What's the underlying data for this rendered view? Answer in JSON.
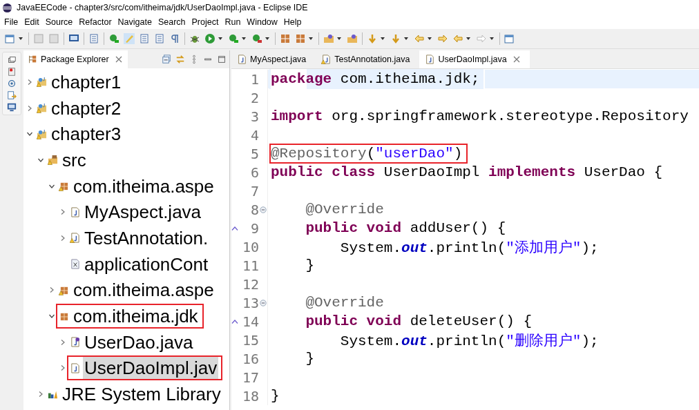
{
  "window": {
    "title": "JavaEECode - chapter3/src/com/itheima/jdk/UserDaoImpl.java - Eclipse IDE"
  },
  "menu": [
    {
      "label": "File"
    },
    {
      "label": "Edit"
    },
    {
      "label": "Source"
    },
    {
      "label": "Refactor"
    },
    {
      "label": "Navigate"
    },
    {
      "label": "Search"
    },
    {
      "label": "Project"
    },
    {
      "label": "Run"
    },
    {
      "label": "Window"
    },
    {
      "label": "Help"
    }
  ],
  "package_explorer": {
    "title": "Package Explorer",
    "tree": [
      {
        "label": "chapter1",
        "kind": "project",
        "warning": true,
        "expanded": false,
        "selected": false,
        "highlighted": false
      },
      {
        "label": "chapter2",
        "kind": "project",
        "warning": true,
        "expanded": false,
        "selected": false,
        "highlighted": false
      },
      {
        "label": "chapter3",
        "kind": "project",
        "warning": true,
        "expanded": true,
        "selected": false,
        "highlighted": false,
        "children": [
          {
            "label": "src",
            "kind": "source-folder",
            "warning": true,
            "expanded": true,
            "selected": false,
            "highlighted": false,
            "children": [
              {
                "label": "com.itheima.aspe",
                "kind": "package",
                "warning": true,
                "expanded": true,
                "selected": false,
                "highlighted": false,
                "children": [
                  {
                    "label": "MyAspect.java",
                    "kind": "java-file",
                    "warning": false,
                    "expanded": false,
                    "selected": false,
                    "highlighted": false
                  },
                  {
                    "label": "TestAnnotation.",
                    "kind": "java-file",
                    "warning": true,
                    "expanded": false,
                    "selected": false,
                    "highlighted": false
                  },
                  {
                    "label": "applicationCont",
                    "kind": "xml-file",
                    "warning": false,
                    "selected": false,
                    "highlighted": false
                  }
                ]
              },
              {
                "label": "com.itheima.aspe",
                "kind": "package",
                "warning": true,
                "expanded": false,
                "selected": false,
                "highlighted": false
              },
              {
                "label": "com.itheima.jdk",
                "kind": "package",
                "warning": false,
                "expanded": true,
                "selected": false,
                "highlighted": true,
                "children": [
                  {
                    "label": "UserDao.java",
                    "kind": "interface-file",
                    "warning": false,
                    "expanded": false,
                    "selected": false,
                    "highlighted": false
                  },
                  {
                    "label": "UserDaoImpl.jav",
                    "kind": "java-file",
                    "warning": false,
                    "expanded": false,
                    "selected": true,
                    "highlighted": true
                  }
                ]
              }
            ]
          },
          {
            "label": "JRE System Library",
            "kind": "library",
            "warning": false,
            "expanded": false,
            "selected": false,
            "highlighted": false
          }
        ]
      }
    ]
  },
  "editor": {
    "tabs": [
      {
        "label": "MyAspect.java",
        "warning": false,
        "selected": false
      },
      {
        "label": "TestAnnotation.java",
        "warning": true,
        "selected": false
      },
      {
        "label": "UserDaoImpl.java",
        "warning": false,
        "selected": true
      }
    ],
    "lines": [
      {
        "number": "1",
        "current": true,
        "fold": false,
        "override": false,
        "highlighted": false,
        "tokens": [
          {
            "kind": "keyword",
            "text": "package"
          },
          {
            "kind": "plain",
            "text": " com.itheima.jdk;"
          }
        ]
      },
      {
        "number": "2",
        "current": false,
        "fold": false,
        "override": false,
        "highlighted": false
      },
      {
        "number": "3",
        "current": false,
        "fold": false,
        "override": false,
        "highlighted": false,
        "tokens": [
          {
            "kind": "keyword",
            "text": "import"
          },
          {
            "kind": "plain",
            "text": " org.springframework.stereotype.Repository"
          }
        ]
      },
      {
        "number": "4",
        "current": false,
        "fold": false,
        "override": false,
        "highlighted": false
      },
      {
        "number": "5",
        "current": false,
        "fold": false,
        "override": false,
        "highlighted": true,
        "tokens": [
          {
            "kind": "annotation",
            "text": "@Repository"
          },
          {
            "kind": "plain",
            "text": "("
          },
          {
            "kind": "string",
            "text": "\"userDao\""
          },
          {
            "kind": "plain",
            "text": ")"
          }
        ]
      },
      {
        "number": "6",
        "current": false,
        "fold": false,
        "override": false,
        "highlighted": false,
        "tokens": [
          {
            "kind": "keyword",
            "text": "public class"
          },
          {
            "kind": "plain",
            "text": " UserDaoImpl "
          },
          {
            "kind": "keyword",
            "text": "implements"
          },
          {
            "kind": "plain",
            "text": " UserDao {"
          }
        ]
      },
      {
        "number": "7",
        "current": false,
        "fold": false,
        "override": false,
        "highlighted": false
      },
      {
        "number": "8",
        "current": false,
        "fold": true,
        "override": false,
        "highlighted": false,
        "tokens": [
          {
            "kind": "annotation",
            "text": "    @Override"
          }
        ]
      },
      {
        "number": "9",
        "current": false,
        "fold": false,
        "override": true,
        "highlighted": false,
        "tokens": [
          {
            "kind": "keyword",
            "text": "    public void"
          },
          {
            "kind": "plain",
            "text": " addUser() {"
          }
        ]
      },
      {
        "number": "10",
        "current": false,
        "fold": false,
        "override": false,
        "highlighted": false,
        "tokens": [
          {
            "kind": "plain",
            "text": "        System."
          },
          {
            "kind": "field",
            "text": "out"
          },
          {
            "kind": "plain",
            "text": ".println("
          },
          {
            "kind": "string",
            "text": "\"添加用户\""
          },
          {
            "kind": "plain",
            "text": ");"
          }
        ]
      },
      {
        "number": "11",
        "current": false,
        "fold": false,
        "override": false,
        "highlighted": false,
        "tokens": [
          {
            "kind": "plain",
            "text": "    }"
          }
        ]
      },
      {
        "number": "12",
        "current": false,
        "fold": false,
        "override": false,
        "highlighted": false
      },
      {
        "number": "13",
        "current": false,
        "fold": true,
        "override": false,
        "highlighted": false,
        "tokens": [
          {
            "kind": "annotation",
            "text": "    @Override"
          }
        ]
      },
      {
        "number": "14",
        "current": false,
        "fold": false,
        "override": true,
        "highlighted": false,
        "tokens": [
          {
            "kind": "keyword",
            "text": "    public void"
          },
          {
            "kind": "plain",
            "text": " deleteUser() {"
          }
        ]
      },
      {
        "number": "15",
        "current": false,
        "fold": false,
        "override": false,
        "highlighted": false,
        "tokens": [
          {
            "kind": "plain",
            "text": "        System."
          },
          {
            "kind": "field",
            "text": "out"
          },
          {
            "kind": "plain",
            "text": ".println("
          },
          {
            "kind": "string",
            "text": "\"删除用户\""
          },
          {
            "kind": "plain",
            "text": ");"
          }
        ]
      },
      {
        "number": "16",
        "current": false,
        "fold": false,
        "override": false,
        "highlighted": false,
        "tokens": [
          {
            "kind": "plain",
            "text": "    }"
          }
        ]
      },
      {
        "number": "17",
        "current": false,
        "fold": false,
        "override": false,
        "highlighted": false
      },
      {
        "number": "18",
        "current": false,
        "fold": false,
        "override": false,
        "highlighted": false,
        "tokens": [
          {
            "kind": "plain",
            "text": "}"
          }
        ]
      }
    ]
  }
}
